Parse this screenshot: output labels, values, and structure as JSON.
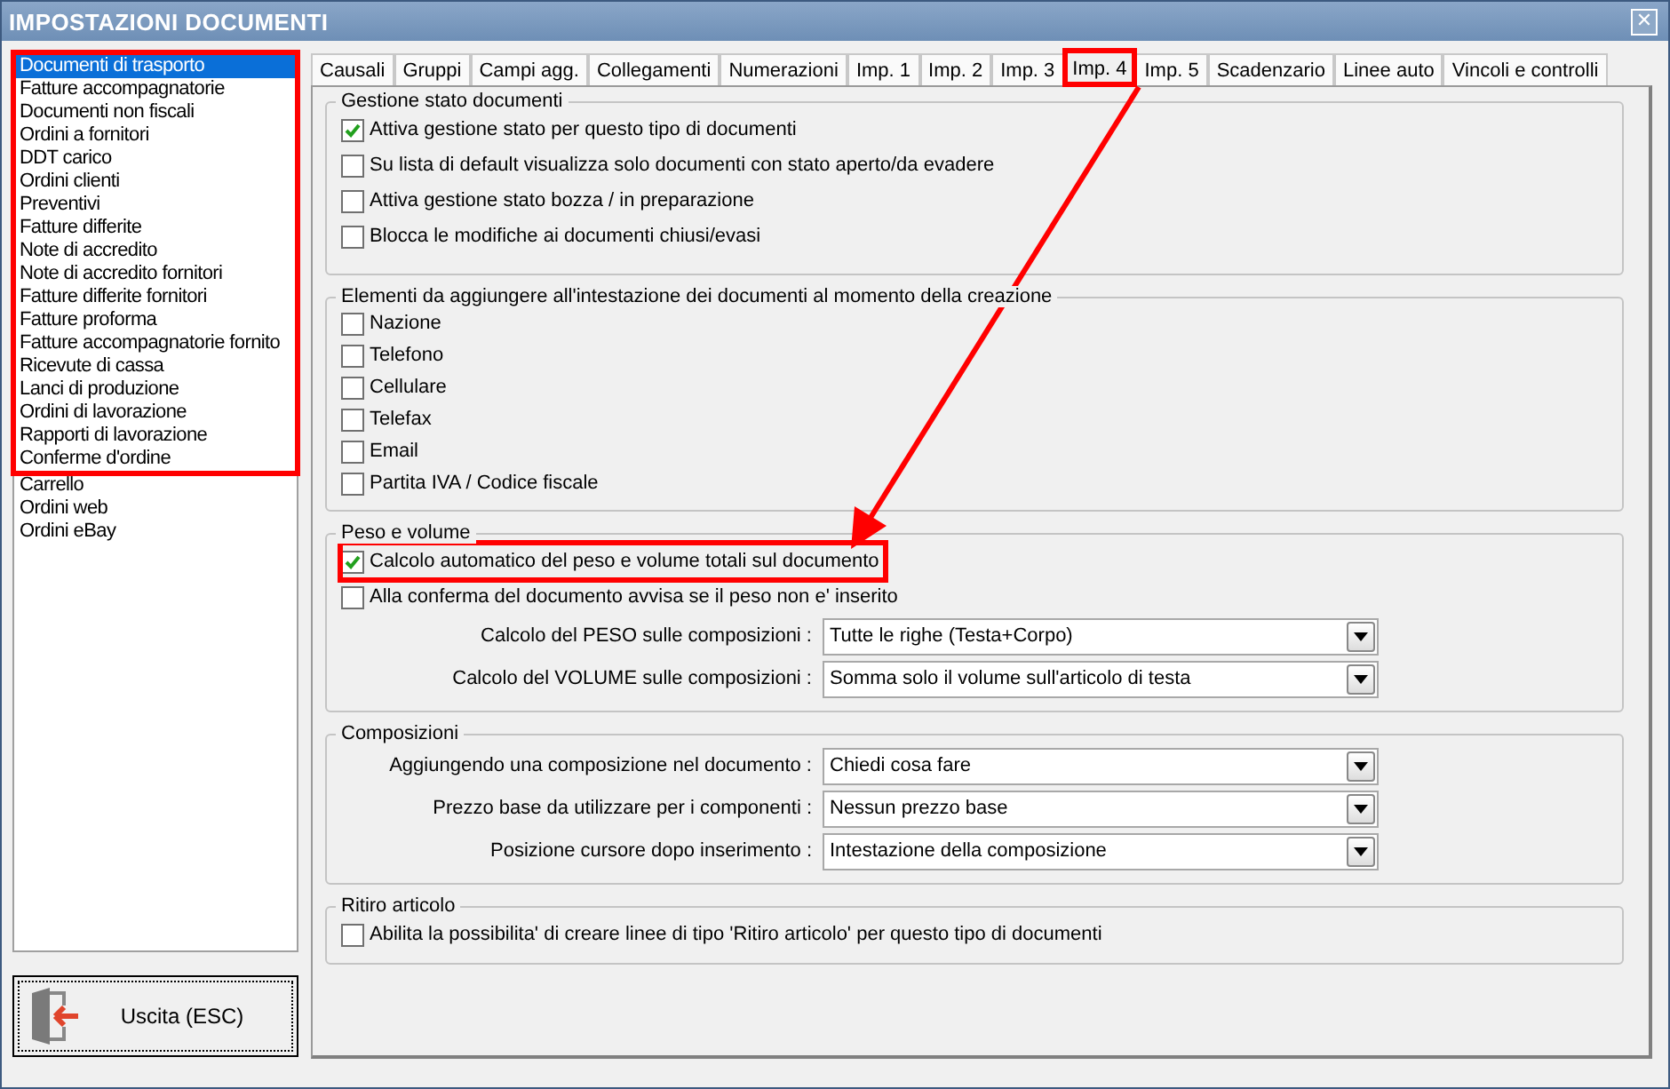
{
  "window": {
    "title": "IMPOSTAZIONI DOCUMENTI",
    "close": "✕"
  },
  "sidebar": {
    "groups": [
      {
        "highlighted": true,
        "items": [
          {
            "label": "Documenti di trasporto",
            "selected": true
          },
          {
            "label": "Fatture accompagnatorie",
            "selected": false
          },
          {
            "label": "Documenti non fiscali",
            "selected": false
          },
          {
            "label": "Ordini a fornitori",
            "selected": false
          },
          {
            "label": "DDT carico",
            "selected": false
          },
          {
            "label": "Ordini clienti",
            "selected": false
          },
          {
            "label": "Preventivi",
            "selected": false
          },
          {
            "label": "Fatture differite",
            "selected": false
          },
          {
            "label": "Note di accredito",
            "selected": false
          },
          {
            "label": "Note di accredito fornitori",
            "selected": false
          },
          {
            "label": "Fatture differite fornitori",
            "selected": false
          },
          {
            "label": "Fatture proforma",
            "selected": false
          },
          {
            "label": "Fatture accompagnatorie fornito",
            "selected": false
          },
          {
            "label": "Ricevute di cassa",
            "selected": false
          },
          {
            "label": "Lanci di produzione",
            "selected": false
          },
          {
            "label": "Ordini di lavorazione",
            "selected": false
          },
          {
            "label": "Rapporti di lavorazione",
            "selected": false
          },
          {
            "label": "Conferme d'ordine",
            "selected": false
          }
        ]
      },
      {
        "highlighted": false,
        "items": [
          {
            "label": "Carrello",
            "selected": false
          },
          {
            "label": "Ordini web",
            "selected": false
          },
          {
            "label": "Ordini eBay",
            "selected": false
          }
        ]
      }
    ]
  },
  "exit_button": {
    "label": "Uscita (ESC)"
  },
  "tabs": [
    {
      "label": "Causali",
      "selected": false,
      "highlighted": false
    },
    {
      "label": "Gruppi",
      "selected": false,
      "highlighted": false
    },
    {
      "label": "Campi agg.",
      "selected": false,
      "highlighted": false
    },
    {
      "label": "Collegamenti",
      "selected": false,
      "highlighted": false
    },
    {
      "label": "Numerazioni",
      "selected": false,
      "highlighted": false
    },
    {
      "label": "Imp. 1",
      "selected": false,
      "highlighted": false
    },
    {
      "label": "Imp. 2",
      "selected": false,
      "highlighted": false
    },
    {
      "label": "Imp. 3",
      "selected": false,
      "highlighted": false
    },
    {
      "label": "Imp. 4",
      "selected": true,
      "highlighted": true
    },
    {
      "label": "Imp. 5",
      "selected": false,
      "highlighted": false
    },
    {
      "label": "Scadenzario",
      "selected": false,
      "highlighted": false
    },
    {
      "label": "Linee auto",
      "selected": false,
      "highlighted": false
    },
    {
      "label": "Vincoli e controlli",
      "selected": false,
      "highlighted": false
    }
  ],
  "groups": [
    {
      "title": "Gestione stato documenti",
      "kind": "checks",
      "checkboxes": [
        {
          "label": "Attiva gestione stato per questo tipo di documenti",
          "checked": true,
          "highlighted": false
        },
        {
          "label": "Su lista di default visualizza solo documenti con stato aperto/da evadere",
          "checked": false,
          "highlighted": false
        },
        {
          "label": "Attiva gestione stato bozza / in preparazione",
          "checked": false,
          "highlighted": false
        },
        {
          "label": "Blocca le modifiche ai documenti chiusi/evasi",
          "checked": false,
          "highlighted": false
        }
      ]
    },
    {
      "title": "Elementi da aggiungere all'intestazione dei documenti al momento della creazione",
      "kind": "compact",
      "checkboxes": [
        {
          "label": "Nazione",
          "checked": false,
          "highlighted": false
        },
        {
          "label": "Telefono",
          "checked": false,
          "highlighted": false
        },
        {
          "label": "Cellulare",
          "checked": false,
          "highlighted": false
        },
        {
          "label": "Telefax",
          "checked": false,
          "highlighted": false
        },
        {
          "label": "Email",
          "checked": false,
          "highlighted": false
        },
        {
          "label": "Partita IVA / Codice fiscale",
          "checked": false,
          "highlighted": false
        }
      ]
    },
    {
      "title": "Peso e volume",
      "kind": "checks",
      "checkboxes": [
        {
          "label": "Calcolo automatico del peso e volume totali sul documento",
          "checked": true,
          "highlighted": true
        },
        {
          "label": "Alla conferma del documento avvisa se il peso non e' inserito",
          "checked": false,
          "highlighted": false
        }
      ],
      "selects": [
        {
          "label": "Calcolo del PESO sulle composizioni :",
          "value": "Tutte le righe (Testa+Corpo)"
        },
        {
          "label": "Calcolo del VOLUME sulle composizioni :",
          "value": "Somma solo il volume sull'articolo di testa"
        }
      ]
    },
    {
      "title": "Composizioni",
      "kind": "selects",
      "selects": [
        {
          "label": "Aggiungendo una composizione nel documento :",
          "value": "Chiedi cosa fare"
        },
        {
          "label": "Prezzo base da utilizzare per i componenti :",
          "value": "Nessun prezzo base"
        },
        {
          "label": "Posizione cursore dopo inserimento :",
          "value": "Intestazione della composizione"
        }
      ]
    },
    {
      "title": "Ritiro articolo",
      "kind": "checks",
      "checkboxes": [
        {
          "label": "Abilita la possibilita' di creare linee di tipo 'Ritiro articolo' per questo tipo di documenti",
          "checked": false,
          "highlighted": false
        }
      ]
    }
  ],
  "annotation_arrow": true
}
